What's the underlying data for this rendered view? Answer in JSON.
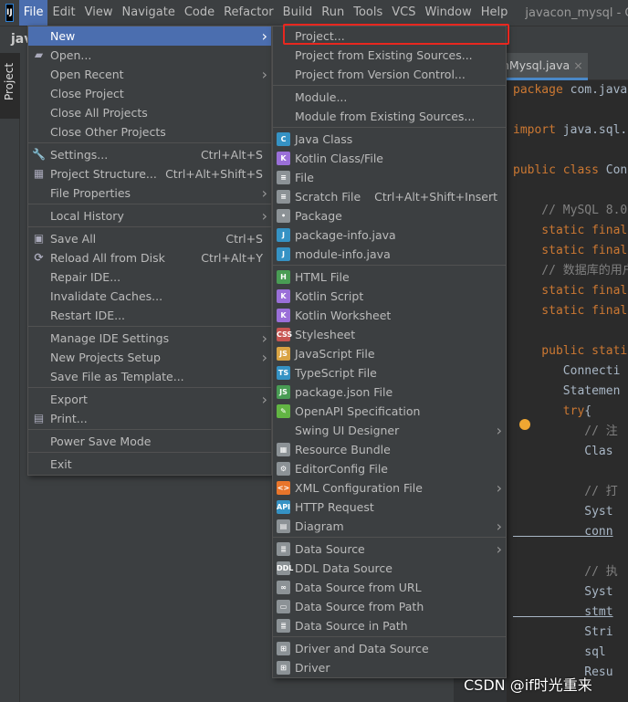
{
  "menubar": {
    "items": [
      "File",
      "Edit",
      "View",
      "Navigate",
      "Code",
      "Refactor",
      "Build",
      "Run",
      "Tools",
      "VCS",
      "Window",
      "Help"
    ],
    "title": "javacon_mysql - Co"
  },
  "project": {
    "name": "jav",
    "tab": "Project"
  },
  "editor": {
    "tab": "nMysql.java",
    "lines": [
      [
        [
          "package ",
          "kw"
        ],
        [
          "com.java",
          "tx"
        ]
      ],
      [],
      [
        [
          "import ",
          "kw"
        ],
        [
          "java.sql.",
          "tx"
        ]
      ],
      [],
      [
        [
          "public class ",
          "kw"
        ],
        [
          "Con",
          "tx"
        ]
      ],
      [],
      [
        [
          "    // MySQL 8.0",
          "cm"
        ]
      ],
      [
        [
          "    static final",
          "kw"
        ]
      ],
      [
        [
          "    static final",
          "kw"
        ]
      ],
      [
        [
          "    // 数据库的用户",
          "cm"
        ]
      ],
      [
        [
          "    static final",
          "kw"
        ]
      ],
      [
        [
          "    static final",
          "kw"
        ]
      ],
      [],
      [
        [
          "    public stati",
          "kw"
        ]
      ],
      [
        [
          "       Connecti",
          "tx"
        ]
      ],
      [
        [
          "       Statemen",
          "tx"
        ]
      ],
      [
        [
          "       try",
          "kw"
        ],
        [
          "{",
          "tx"
        ]
      ],
      [
        [
          "          // 注",
          "cm"
        ]
      ],
      [
        [
          "          Clas",
          "tx"
        ]
      ],
      [],
      [
        [
          "          // 打",
          "cm"
        ]
      ],
      [
        [
          "          Syst",
          "tx"
        ]
      ],
      [
        [
          "          conn",
          "tx ul"
        ]
      ],
      [],
      [
        [
          "          // 执",
          "cm"
        ]
      ],
      [
        [
          "          Syst",
          "tx"
        ]
      ],
      [
        [
          "          stmt",
          "tx ul"
        ]
      ],
      [
        [
          "          Stri",
          "tx"
        ]
      ],
      [
        [
          "          sql ",
          "tx"
        ]
      ],
      [
        [
          "          Resu",
          "tx"
        ]
      ]
    ]
  },
  "file_menu": [
    {
      "label": "New",
      "arrow": true,
      "selected": true
    },
    {
      "label": "Open...",
      "icon": "folder-icon"
    },
    {
      "label": "Open Recent",
      "arrow": true
    },
    {
      "label": "Close Project"
    },
    {
      "label": "Close All Projects"
    },
    {
      "label": "Close Other Projects"
    },
    {
      "sep": true
    },
    {
      "label": "Settings...",
      "shortcut": "Ctrl+Alt+S",
      "icon": "wrench-icon"
    },
    {
      "label": "Project Structure...",
      "shortcut": "Ctrl+Alt+Shift+S",
      "icon": "project-structure-icon"
    },
    {
      "label": "File Properties",
      "arrow": true
    },
    {
      "sep": true
    },
    {
      "label": "Local History",
      "arrow": true
    },
    {
      "sep": true
    },
    {
      "label": "Save All",
      "shortcut": "Ctrl+S",
      "icon": "save-icon"
    },
    {
      "label": "Reload All from Disk",
      "shortcut": "Ctrl+Alt+Y",
      "icon": "reload-icon"
    },
    {
      "label": "Repair IDE..."
    },
    {
      "label": "Invalidate Caches..."
    },
    {
      "label": "Restart IDE..."
    },
    {
      "sep": true
    },
    {
      "label": "Manage IDE Settings",
      "arrow": true
    },
    {
      "label": "New Projects Setup",
      "arrow": true
    },
    {
      "label": "Save File as Template..."
    },
    {
      "sep": true
    },
    {
      "label": "Export",
      "arrow": true
    },
    {
      "label": "Print...",
      "icon": "print-icon"
    },
    {
      "sep": true
    },
    {
      "label": "Power Save Mode"
    },
    {
      "sep": true
    },
    {
      "label": "Exit"
    }
  ],
  "new_menu": [
    {
      "label": "Project..."
    },
    {
      "label": "Project from Existing Sources..."
    },
    {
      "label": "Project from Version Control..."
    },
    {
      "sep": true
    },
    {
      "label": "Module..."
    },
    {
      "label": "Module from Existing Sources..."
    },
    {
      "sep": true
    },
    {
      "label": "Java Class",
      "icon": "java-class-icon",
      "color": "#3592c4",
      "glyph": "C"
    },
    {
      "label": "Kotlin Class/File",
      "icon": "kotlin-file-icon",
      "color": "#9a6fd8",
      "glyph": "K"
    },
    {
      "label": "File",
      "icon": "file-icon",
      "color": "#8c9296",
      "glyph": "≡"
    },
    {
      "label": "Scratch File",
      "shortcut": "Ctrl+Alt+Shift+Insert",
      "icon": "scratch-file-icon",
      "color": "#8c9296",
      "glyph": "≡"
    },
    {
      "label": "Package",
      "icon": "package-icon",
      "color": "#8c9296",
      "glyph": "•"
    },
    {
      "label": "package-info.java",
      "icon": "java-file-icon",
      "color": "#3592c4",
      "glyph": "J"
    },
    {
      "label": "module-info.java",
      "icon": "java-file-icon",
      "color": "#3592c4",
      "glyph": "J"
    },
    {
      "sep": true
    },
    {
      "label": "HTML File",
      "icon": "html-file-icon",
      "color": "#499c54",
      "glyph": "H"
    },
    {
      "label": "Kotlin Script",
      "icon": "kotlin-script-icon",
      "color": "#9a6fd8",
      "glyph": "K"
    },
    {
      "label": "Kotlin Worksheet",
      "icon": "kotlin-worksheet-icon",
      "color": "#9a6fd8",
      "glyph": "K"
    },
    {
      "label": "Stylesheet",
      "icon": "css-file-icon",
      "color": "#c75450",
      "glyph": "CSS"
    },
    {
      "label": "JavaScript File",
      "icon": "js-file-icon",
      "color": "#d9a343",
      "glyph": "JS"
    },
    {
      "label": "TypeScript File",
      "icon": "ts-file-icon",
      "color": "#3592c4",
      "glyph": "TS"
    },
    {
      "label": "package.json File",
      "icon": "nodejs-icon",
      "color": "#499c54",
      "glyph": "JS"
    },
    {
      "label": "OpenAPI Specification",
      "icon": "openapi-icon",
      "color": "#62b543",
      "glyph": "✎"
    },
    {
      "label": "Swing UI Designer",
      "arrow": true
    },
    {
      "label": "Resource Bundle",
      "icon": "resource-bundle-icon",
      "color": "#8c9296",
      "glyph": "▦"
    },
    {
      "label": "EditorConfig File",
      "icon": "gear-icon",
      "color": "#8c9296",
      "glyph": "⚙"
    },
    {
      "label": "XML Configuration File",
      "arrow": true,
      "icon": "xml-file-icon",
      "color": "#e8752b",
      "glyph": "<>"
    },
    {
      "label": "HTTP Request",
      "icon": "http-request-icon",
      "color": "#3592c4",
      "glyph": "API"
    },
    {
      "label": "Diagram",
      "arrow": true,
      "icon": "diagram-icon",
      "color": "#8c9296",
      "glyph": "▤"
    },
    {
      "sep": true
    },
    {
      "label": "Data Source",
      "arrow": true,
      "icon": "database-icon",
      "color": "#8c9296",
      "glyph": "≣"
    },
    {
      "label": "DDL Data Source",
      "icon": "ddl-icon",
      "color": "#8c9296",
      "glyph": "DDL"
    },
    {
      "label": "Data Source from URL",
      "icon": "url-icon",
      "color": "#8c9296",
      "glyph": "∞"
    },
    {
      "label": "Data Source from Path",
      "icon": "folder-icon",
      "color": "#8c9296",
      "glyph": "▭"
    },
    {
      "label": "Data Source in Path",
      "icon": "database-icon",
      "color": "#8c9296",
      "glyph": "≣"
    },
    {
      "sep": true
    },
    {
      "label": "Driver and Data Source",
      "icon": "driver-icon",
      "color": "#8c9296",
      "glyph": "⊞"
    },
    {
      "label": "Driver",
      "icon": "driver-icon",
      "color": "#8c9296",
      "glyph": "⊞"
    }
  ],
  "watermark": "CSDN @if时光重来",
  "colors": {
    "selection": "#4b6eaf",
    "highlight_box": "#e8271f",
    "keyword": "#cc7832"
  }
}
